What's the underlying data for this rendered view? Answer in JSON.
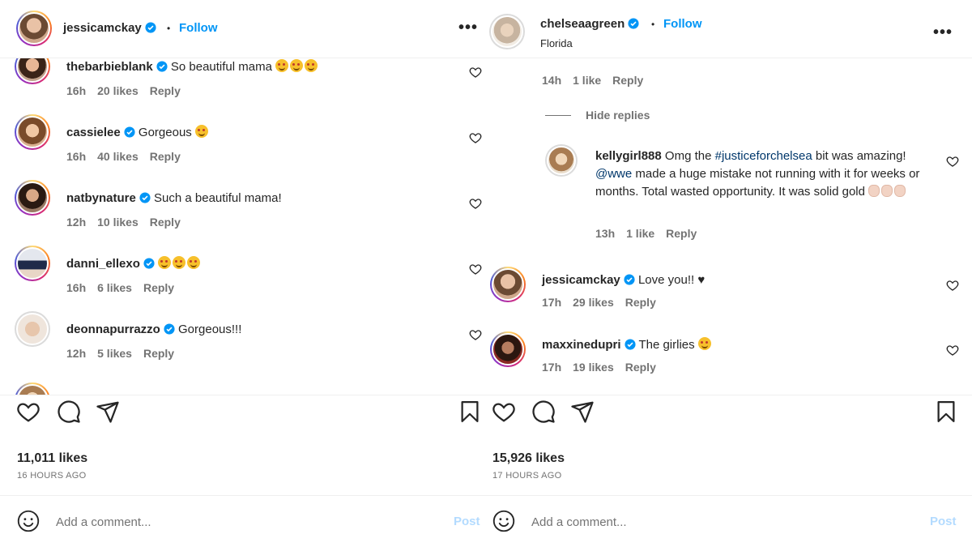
{
  "left_post": {
    "header": {
      "username": "jessicamckay",
      "follow_label": "Follow",
      "separator": "•"
    },
    "comments": [
      {
        "username": "thebarbieblank",
        "text": "So beautiful mama",
        "emoji_count": 3,
        "time": "16h",
        "likes": "20 likes",
        "reply_label": "Reply"
      },
      {
        "username": "cassielee",
        "text": "Gorgeous",
        "emoji_count": 1,
        "time": "16h",
        "likes": "40 likes",
        "reply_label": "Reply"
      },
      {
        "username": "natbynature",
        "text": "Such a beautiful mama!",
        "emoji_count": 0,
        "time": "12h",
        "likes": "10 likes",
        "reply_label": "Reply"
      },
      {
        "username": "danni_ellexo",
        "text": "",
        "emoji_count": 3,
        "time": "16h",
        "likes": "6 likes",
        "reply_label": "Reply"
      },
      {
        "username": "deonnapurrazzo",
        "text": "Gorgeous!!!",
        "emoji_count": 0,
        "time": "12h",
        "likes": "5 likes",
        "reply_label": "Reply"
      }
    ],
    "likes": "11,011 likes",
    "time_ago": "16 HOURS AGO",
    "add_comment_placeholder": "Add a comment...",
    "post_label": "Post"
  },
  "right_post": {
    "header": {
      "username": "chelseaagreen",
      "follow_label": "Follow",
      "separator": "•",
      "location": "Florida"
    },
    "first_meta": {
      "time": "14h",
      "likes": "1 like",
      "reply_label": "Reply"
    },
    "hide_replies_label": "Hide replies",
    "reply": {
      "username": "kellygirl888",
      "text_before": "Omg the",
      "hashtag": "#justiceforchelsea",
      "text_mid": "bit was amazing!",
      "mention": "@wwe",
      "text_after": "made a huge mistake not running with it for weeks or months. Total wasted opportunity. It was solid gold",
      "time": "13h",
      "likes": "1 like",
      "reply_label": "Reply"
    },
    "comments": [
      {
        "username": "jessicamckay",
        "text": "Love you!! ♥",
        "time": "17h",
        "likes": "29 likes",
        "reply_label": "Reply"
      },
      {
        "username": "maxxinedupri",
        "text": "The girlies",
        "time": "17h",
        "likes": "19 likes",
        "reply_label": "Reply"
      }
    ],
    "likes": "15,926 likes",
    "time_ago": "17 HOURS AGO",
    "add_comment_placeholder": "Add a comment...",
    "post_label": "Post"
  },
  "colors": {
    "accent": "#0095f6",
    "verified": "#0095f6",
    "post_disabled": "#b3dbff",
    "link": "#00376b"
  },
  "icons": [
    "heart-icon",
    "comment-icon",
    "share-icon",
    "bookmark-icon",
    "emoji-icon",
    "verified-badge-icon",
    "more-options-icon"
  ]
}
